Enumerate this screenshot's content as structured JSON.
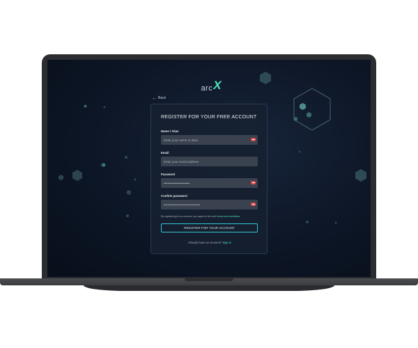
{
  "app": {
    "logo_text": "arc",
    "logo_mark": "X"
  },
  "nav": {
    "back_icon": "arrow-left-icon",
    "back_label": "Back"
  },
  "form": {
    "title": "REGISTER FOR YOUR FREE ACCOUNT",
    "fields": [
      {
        "label": "Name / Alias",
        "placeholder": "Enter your name or alias",
        "value": "",
        "badge": true
      },
      {
        "label": "Email",
        "placeholder": "Enter your email address",
        "value": "",
        "badge": false
      },
      {
        "label": "Password",
        "placeholder": "",
        "value": "••••••••••••••••••••",
        "badge": true
      },
      {
        "label": "Confirm password",
        "placeholder": "",
        "value": "••••••••••••••••••••••••••••",
        "badge": true
      }
    ],
    "terms_prefix": "By registering for an account, you agree to the arcX",
    "terms_link": "terms and conditions",
    "submit_label": "REGISTER FOR YOUR ACCOUNT",
    "signin_prompt": "Already have an account?",
    "signin_link": "Sign in"
  },
  "colors": {
    "accent": "#4fe0b8",
    "button_border": "#39c6d4",
    "badge": "#e04a4a",
    "background": "#0d1626"
  }
}
